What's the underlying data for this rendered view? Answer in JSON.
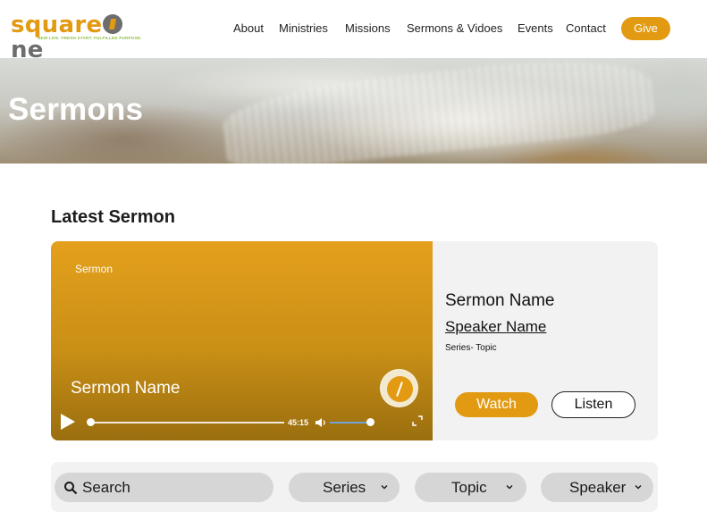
{
  "header": {
    "logo": {
      "square": "square",
      "one_prefix": "",
      "one_suffix": "ne",
      "tagline": "NEW LIFE. FRESH START. FULFILLED PURPOSE."
    },
    "nav": [
      "About",
      "Ministries",
      "Missions",
      "Sermons & Vidoes",
      "Events",
      "Contact"
    ],
    "give_label": "Give"
  },
  "hero": {
    "title": "Sermons"
  },
  "latest": {
    "section_title": "Latest Sermon",
    "player": {
      "label": "Sermon",
      "title": "Sermon Name",
      "time": "45:15",
      "progress": 0,
      "volume": 0.9
    },
    "info": {
      "name": "Sermon Name",
      "speaker": "Speaker Name",
      "series_topic": "Series- Topic"
    },
    "watch_label": "Watch",
    "listen_label": "Listen"
  },
  "filters": {
    "search_placeholder": "Search",
    "series_label": "Series",
    "topic_label": "Topic",
    "speaker_label": "Speaker"
  },
  "colors": {
    "accent": "#e29a12",
    "logo_gray": "#6d6d6d",
    "logo_green": "#8cbf3f"
  }
}
